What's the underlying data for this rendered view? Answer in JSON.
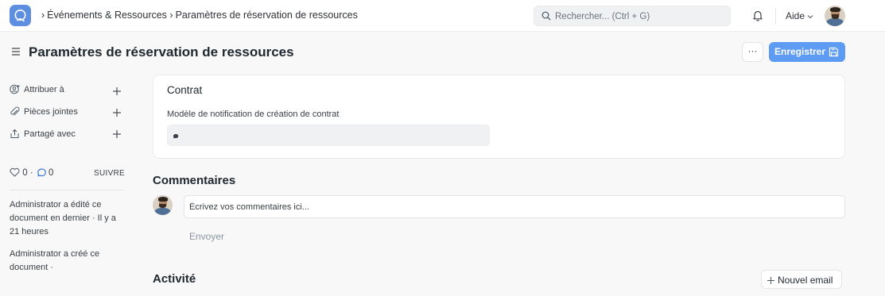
{
  "navbar": {
    "breadcrumbs": [
      "Événements & Ressources",
      "Paramètres de réservation de ressources"
    ],
    "search_placeholder": "Rechercher... (Ctrl + G)",
    "help_label": "Aide"
  },
  "page": {
    "title": "Paramètres de réservation de ressources",
    "more_label": "···",
    "save_label": "Enregistrer"
  },
  "sidebar": {
    "items": [
      {
        "label": "Attribuer à",
        "icon": "assign-user-icon"
      },
      {
        "label": "Pièces jointes",
        "icon": "paperclip-icon"
      },
      {
        "label": "Partagé avec",
        "icon": "share-icon"
      }
    ],
    "likes_count": "0",
    "comments_count": "0",
    "follow_label": "SUIVRE",
    "last_edit": "Administrator a édité ce document en dernier · Il y a 21 heures",
    "created": "Administrator a créé ce document ·"
  },
  "card": {
    "title": "Contrat",
    "field_label": "Modèle de notification de création de contrat"
  },
  "comments": {
    "title": "Commentaires",
    "placeholder": "Écrivez vos commentaires ici...",
    "send_label": "Envoyer"
  },
  "activity": {
    "title": "Activité",
    "new_email_label": "Nouvel email"
  },
  "colors": {
    "primary": "#5e9bf3",
    "logo": "#5e8ee0"
  }
}
